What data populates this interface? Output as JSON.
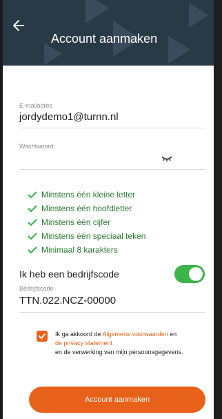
{
  "header": {
    "title": "Account aanmaken",
    "back_icon": "arrow-left-icon",
    "background_color": "#293a47"
  },
  "form": {
    "email": {
      "label": "E-mailadres",
      "value": "jordydemo1@turnn.nl"
    },
    "password": {
      "label": "Wachtwoord",
      "value": "",
      "toggle_icon": "eye-closed-icon"
    },
    "rules": [
      "Minstens één kleine letter",
      "Minstens één hoofdletter",
      "Minstens één cijfer",
      "Minstens één speciaal teken",
      "Minimaal 8 karakters"
    ],
    "rule_color": "#2e7d32",
    "company_toggle": {
      "label": "Ik heb een bedrijfscode",
      "on": true,
      "color": "#3bb54a"
    },
    "company_code": {
      "label": "Bedrijfscode",
      "value": "TTN.022.NCZ-00000"
    },
    "consent": {
      "checked": true,
      "text_prefix": "Ik ga akkoord de ",
      "terms_link": "Algemene voorwaarden",
      "text_and": " en ",
      "privacy_link": "de privacy statement",
      "text_suffix": "en de verwerking van mijn persoonsgegevens."
    },
    "submit_label": "Account aanmaken",
    "accent_color": "#e8611a"
  }
}
